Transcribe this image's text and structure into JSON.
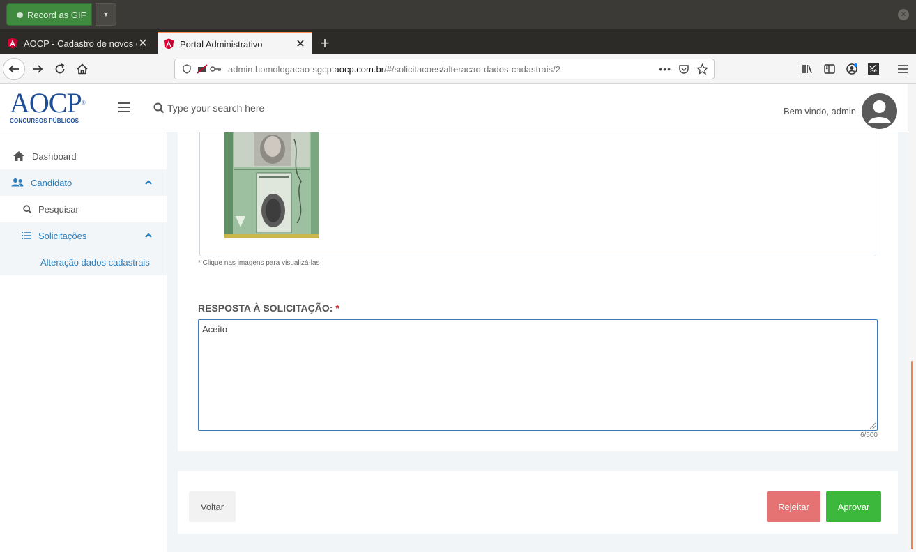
{
  "extension": {
    "record_label": "Record as GIF"
  },
  "tabs": [
    {
      "label": "AOCP - Cadastro de novos c",
      "active": false
    },
    {
      "label": "Portal Administrativo",
      "active": true
    }
  ],
  "address": {
    "url_prefix": "admin.homologacao-sgcp.",
    "url_domain": "aocp.com.br",
    "url_path": "/#/solicitacoes/alteracao-dados-cadastrais/2"
  },
  "header": {
    "logo_main": "AOCP",
    "logo_reg": "®",
    "logo_sub": "CONCURSOS PÚBLICOS",
    "search_placeholder": "Type your search here",
    "welcome": "Bem vindo, admin"
  },
  "sidebar": {
    "items": [
      {
        "label": "Dashboard",
        "icon": "home-icon"
      },
      {
        "label": "Candidato",
        "icon": "users-icon",
        "expanded": true
      },
      {
        "label": "Pesquisar",
        "icon": "search-icon"
      },
      {
        "label": "Solicitações",
        "icon": "list-icon",
        "expanded": true
      },
      {
        "label": "Alteração dados cadastrais"
      }
    ]
  },
  "main": {
    "image_hint": "* Clique nas imagens para visualizá-las",
    "response_label": "RESPOSTA À SOLICITAÇÃO:",
    "required_mark": "*",
    "response_value": "Aceito",
    "char_count": "6/500",
    "buttons": {
      "back": "Voltar",
      "reject": "Rejeitar",
      "approve": "Aprovar"
    }
  },
  "colors": {
    "brand": "#1f4e96",
    "link": "#2a7fc0",
    "reject": "#e57373",
    "approve": "#3cb93c",
    "focus_border": "#3a7bb8"
  }
}
